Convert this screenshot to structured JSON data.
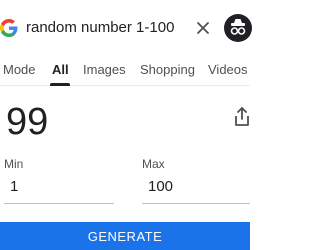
{
  "search": {
    "query": "random number 1-100",
    "logo_icon": "google-g-icon",
    "clear_icon": "close-icon",
    "account_icon": "incognito-icon"
  },
  "tabs": [
    {
      "label": "Mode",
      "active": false
    },
    {
      "label": "All",
      "active": true
    },
    {
      "label": "Images",
      "active": false
    },
    {
      "label": "Shopping",
      "active": false
    },
    {
      "label": "Videos",
      "active": false
    }
  ],
  "generator": {
    "result": "99",
    "share_icon": "share-icon",
    "min_label": "Min",
    "min_value": "1",
    "max_label": "Max",
    "max_value": "100",
    "button_label": "GENERATE"
  },
  "colors": {
    "accent": "#1a73e8",
    "text": "#202124",
    "muted": "#4d5156"
  }
}
